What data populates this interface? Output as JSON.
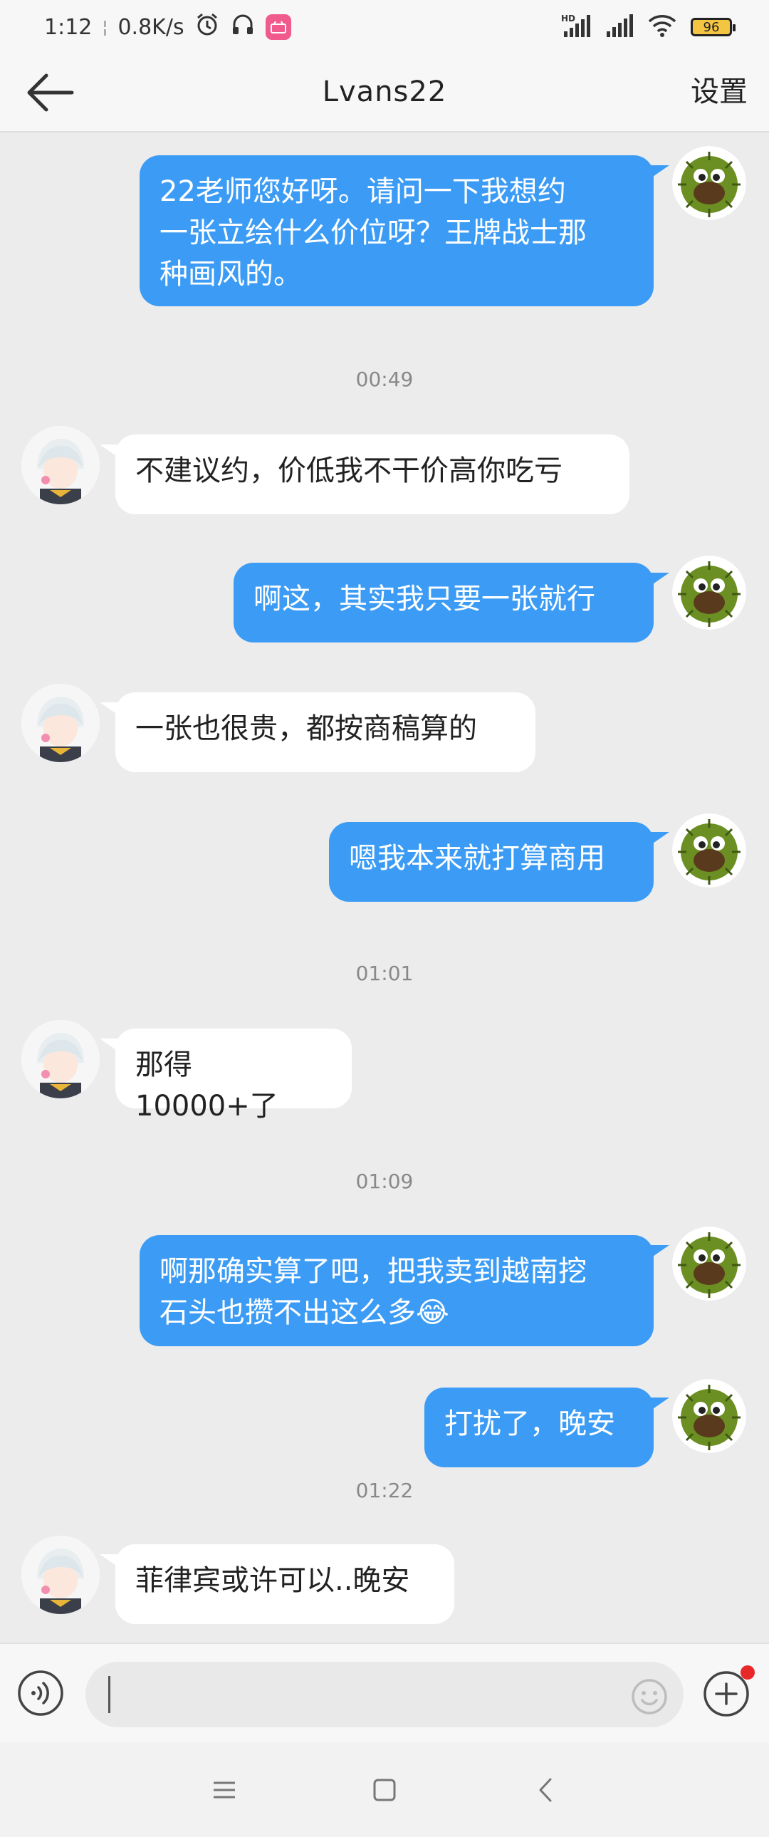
{
  "status_bar": {
    "time": "1:12",
    "network_speed": "0.8K/s",
    "battery": "96",
    "icons": [
      "alarm-icon",
      "headphones-icon",
      "app-notification-icon",
      "signal-hd-icon",
      "signal-icon",
      "wifi-icon",
      "battery-icon"
    ]
  },
  "header": {
    "title": "Lvans22",
    "settings_label": "设置",
    "back_icon": "back-arrow-icon"
  },
  "messages": [
    {
      "type": "me",
      "text": "22老师您好呀。请问一下我想约\n一张立绘什么价位呀？王牌战士那\n种画风的。"
    },
    {
      "type": "time",
      "text": "00:49"
    },
    {
      "type": "them",
      "text": "不建议约，价低我不干价高你吃亏"
    },
    {
      "type": "me",
      "text": "啊这，其实我只要一张就行"
    },
    {
      "type": "them",
      "text": "一张也很贵，都按商稿算的"
    },
    {
      "type": "me",
      "text": "嗯我本来就打算商用"
    },
    {
      "type": "time",
      "text": "01:01"
    },
    {
      "type": "them",
      "text": "那得10000+了"
    },
    {
      "type": "time",
      "text": "01:09"
    },
    {
      "type": "me",
      "text": "啊那确实算了吧，把我卖到越南挖\n石头也攒不出这么多😂"
    },
    {
      "type": "me",
      "text": "打扰了，晚安"
    },
    {
      "type": "time",
      "text": "01:22"
    },
    {
      "type": "them",
      "text": "菲律宾或许可以..晚安"
    }
  ],
  "input_bar": {
    "placeholder": "",
    "value": "",
    "icons": [
      "voice-icon",
      "emoji-icon",
      "plus-icon"
    ]
  },
  "nav_bar": {
    "icons": [
      "menu-icon",
      "home-icon",
      "back-icon"
    ]
  },
  "colors": {
    "my_bubble": "#3c9cf5",
    "their_bubble": "#ffffff",
    "background": "#ececec",
    "notification_dot": "#e82828"
  }
}
